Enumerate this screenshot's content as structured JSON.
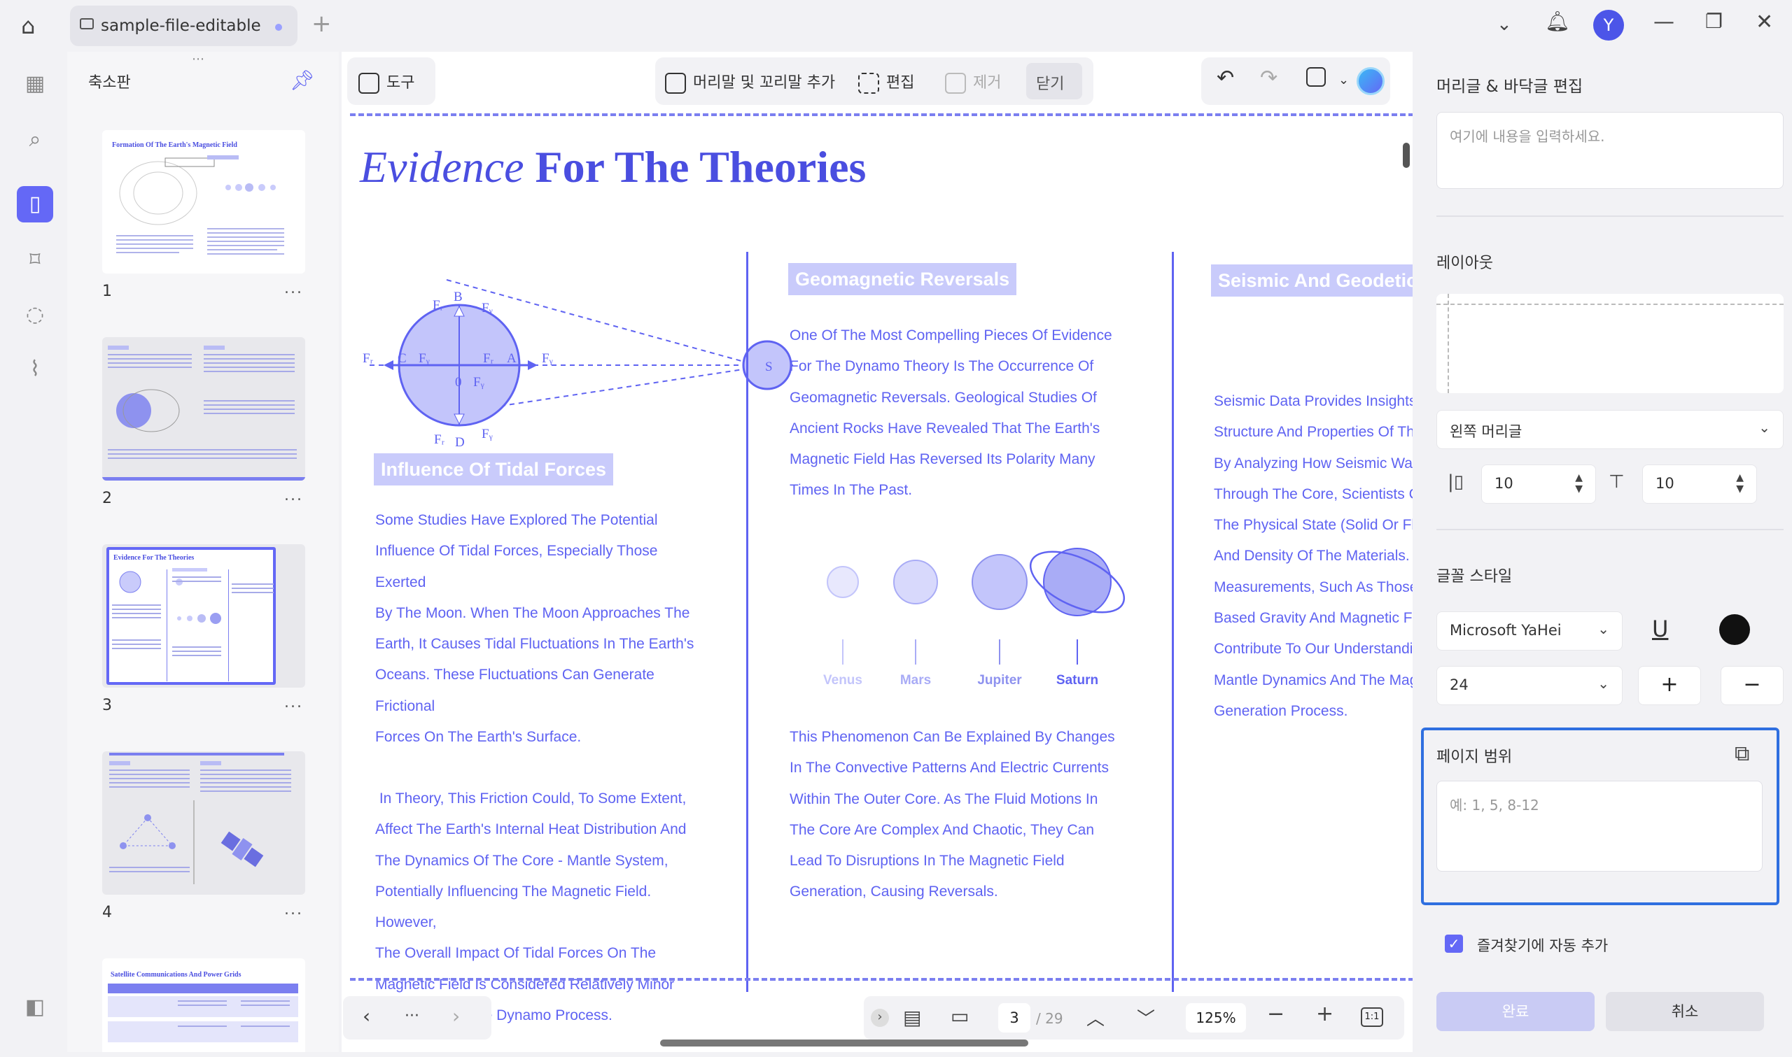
{
  "tab": {
    "title": "sample-file-editable"
  },
  "user": {
    "initial": "Y"
  },
  "thumbs": {
    "title": "축소판",
    "pages": [
      {
        "num": "1",
        "title": "Formation Of The Earth's Magnetic Field"
      },
      {
        "num": "2"
      },
      {
        "num": "3",
        "title": "Evidence For The Theories"
      },
      {
        "num": "4"
      },
      {
        "num": "5",
        "title": "Satellite Communications And Power Grids"
      }
    ],
    "more": "..."
  },
  "toolbar": {
    "tools": "도구",
    "header_footer": "머리말 및 꼬리말 추가",
    "edit": "편집",
    "remove": "제거",
    "close": "닫기"
  },
  "doc": {
    "title_italic": "Evidence",
    "title_bold": "For The Theories",
    "diagram_labels": [
      "Fᵣ",
      "B",
      "Fᵧ",
      "Fᵣ",
      "C",
      "Fᵧ",
      "Fᵣ",
      "A",
      "Fᵧ",
      "0",
      "Fᵧ",
      "Fᵣ",
      "D",
      "Fᵧ",
      "S"
    ],
    "tidal": {
      "heading": "Influence Of Tidal Forces",
      "p1": [
        "Some Studies Have Explored The Potential",
        "Influence Of Tidal Forces, Especially Those Exerted",
        "By The Moon. When The Moon Approaches The",
        "Earth, It Causes Tidal Fluctuations In The Earth's",
        "Oceans. These Fluctuations Can Generate Frictional",
        "Forces On The Earth's Surface."
      ],
      "p2": [
        " In Theory, This Friction Could, To Some Extent,",
        "Affect The Earth's Internal Heat Distribution And",
        "The Dynamics Of The Core - Mantle System,",
        "Potentially Influencing The Magnetic Field. However,",
        "The Overall Impact Of Tidal Forces On The",
        "Magnetic Field Is Considered Relatively Minor",
        "Compared To The Dynamo Process."
      ]
    },
    "geo": {
      "heading": "Geomagnetic Reversals",
      "p1": [
        "One Of The Most Compelling Pieces Of Evidence",
        "For The Dynamo Theory Is The Occurrence Of",
        "Geomagnetic Reversals. Geological Studies Of",
        "Ancient Rocks Have Revealed That The Earth's",
        "Magnetic Field Has Reversed Its Polarity Many",
        "Times In The Past."
      ],
      "planets": [
        "Venus",
        "Mars",
        "Jupiter",
        "Saturn"
      ],
      "p2": [
        "This Phenomenon Can Be Explained By Changes",
        "In The Convective Patterns And Electric Currents",
        "Within The Outer Core. As The Fluid Motions In",
        "The Core Are Complex And Chaotic, They Can",
        "Lead To Disruptions In The Magnetic Field",
        "Generation, Causing Reversals."
      ]
    },
    "seismic": {
      "heading": "Seismic And Geodetic",
      "p1": [
        "Seismic Data Provides Insights",
        "Structure And Properties Of Th",
        "By Analyzing How Seismic Wav",
        "Through The Core, Scientists C",
        "The Physical State (Solid Or Fl",
        "And Density Of The Materials. (",
        "Measurements, Such As Those",
        "Based Gravity And Magnetic Fi",
        "Contribute To Our Understandi",
        "Mantle Dynamics And The Mag",
        "Generation Process."
      ]
    }
  },
  "bottom": {
    "more": "···",
    "page_current": "3",
    "page_total": "/ 29",
    "zoom": "125%",
    "fit": "1:1"
  },
  "panel": {
    "title": "머리글 & 바닥글 편집",
    "content_placeholder": "여기에 내용을 입력하세요.",
    "layout_label": "레이아웃",
    "position_value": "왼쪽 머리글",
    "margin_left": "10",
    "margin_top": "10",
    "font_style_label": "글꼴 스타일",
    "font_value": "Microsoft YaHei",
    "size_value": "24",
    "text_color": "#111111",
    "page_range_label": "페이지 범위",
    "page_range_placeholder": "예: 1, 5, 8-12",
    "auto_bookmark_label": "즐겨찾기에 자동 추가",
    "done": "완료",
    "cancel": "취소"
  }
}
